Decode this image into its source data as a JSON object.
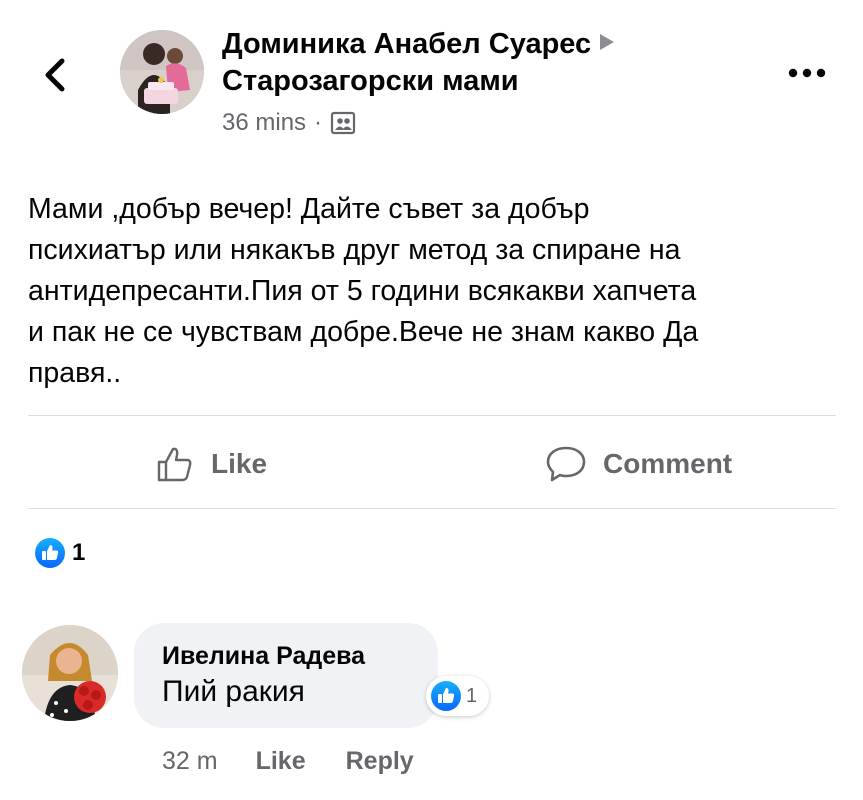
{
  "post": {
    "author": "Доминика Анабел Суарес",
    "group": "Старозагорски мами",
    "time": "36 mins",
    "separator": "·",
    "body": "Мами ,добър вечер! Дайте съвет за добър\nпсихиатър или някакъв друг метод за спиране на\nантидепресанти.Пия от 5 години всякакви хапчета\nи пак не се чувствам  добре.Вече не знам какво Да\nправя.."
  },
  "actions": {
    "like_label": "Like",
    "comment_label": "Comment"
  },
  "reactions": {
    "count": "1"
  },
  "comment": {
    "author": "Ивелина Радева",
    "text": "Пий ракия",
    "reaction_count": "1",
    "time": "32 m",
    "like_label": "Like",
    "reply_label": "Reply"
  },
  "colors": {
    "text_primary": "#050505",
    "text_secondary": "#65676b",
    "divider": "#dadde1",
    "bubble_bg": "#f0f2f5",
    "like_blue": "#1877f2"
  },
  "icons": {
    "back": "chevron-left-icon",
    "more": "ellipsis-icon",
    "arrow": "triangle-right-icon",
    "group": "group-icon",
    "like": "thumbs-up-icon",
    "comment": "speech-bubble-icon",
    "like_reaction": "like-reaction-icon"
  }
}
